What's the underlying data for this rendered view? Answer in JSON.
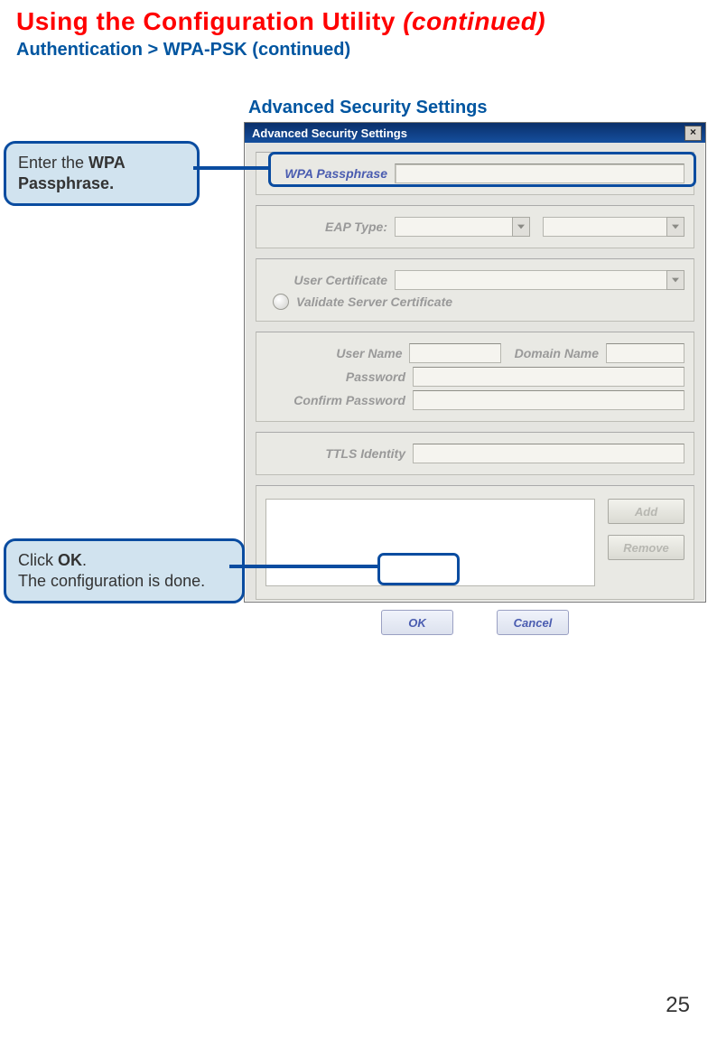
{
  "page": {
    "title_main": "Using the Configuration Utility ",
    "title_cont": "(continued)",
    "subtitle": "Authentication > WPA-PSK (continued)",
    "section_label": "Advanced Security Settings",
    "page_number": "25"
  },
  "dialog": {
    "title": "Advanced Security Settings",
    "close_symbol": "×",
    "labels": {
      "wpa_passphrase": "WPA Passphrase",
      "eap_type": "EAP Type:",
      "user_certificate": "User Certificate",
      "validate_server_cert": "Validate Server Certificate",
      "user_name": "User Name",
      "domain_name": "Domain Name",
      "password": "Password",
      "confirm_password": "Confirm Password",
      "ttls_identity": "TTLS Identity"
    },
    "buttons": {
      "add": "Add",
      "remove": "Remove",
      "ok": "OK",
      "cancel": "Cancel"
    }
  },
  "callouts": {
    "c1_prefix": "Enter the ",
    "c1_bold": "WPA Passphrase.",
    "c2_prefix": "Click ",
    "c2_bold": "OK",
    "c2_suffix1": ".",
    "c2_line2": "The configuration is done."
  }
}
